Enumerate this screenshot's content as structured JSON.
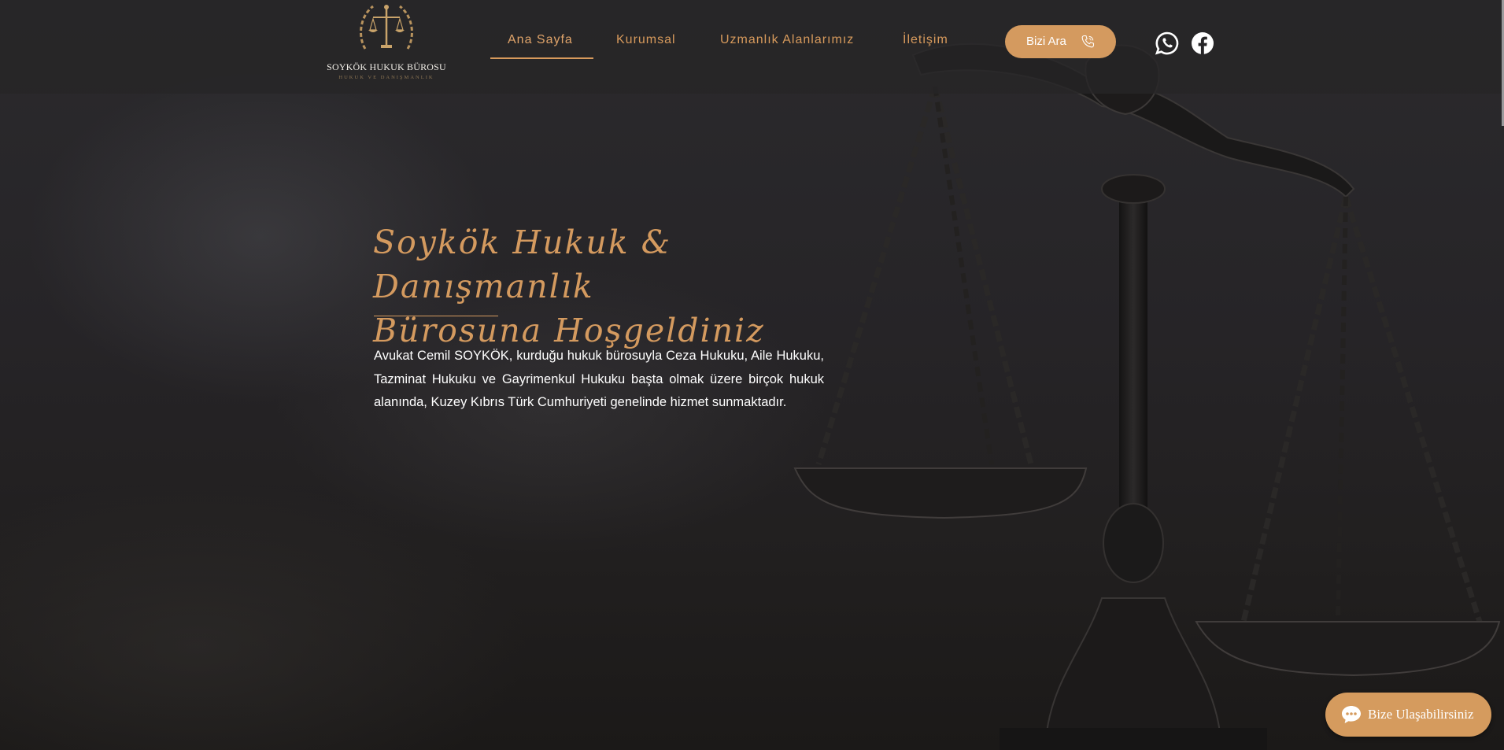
{
  "logo": {
    "name": "SOYKÖK HUKUK BÜROSU",
    "subtitle": "HUKUK VE DANIŞMANLIK",
    "icon": "scales-of-justice-icon"
  },
  "nav": {
    "items": [
      {
        "label": "Ana Sayfa",
        "active": true
      },
      {
        "label": "Kurumsal",
        "active": false
      },
      {
        "label": "Uzmanlık Alanlarımız",
        "active": false
      },
      {
        "label": "İletişim",
        "active": false
      }
    ]
  },
  "call_button": {
    "label": "Bizi Ara",
    "icon": "phone-icon"
  },
  "social": [
    {
      "icon": "whatsapp-icon"
    },
    {
      "icon": "facebook-icon"
    }
  ],
  "hero": {
    "title_line1": "Soykök Hukuk & Danışmanlık",
    "title_line2": "Bürosuna Hoşgeldiniz",
    "body": "Avukat Cemil SOYKÖK, kurduğu hukuk bürosuyla Ceza Hukuku, Aile Hukuku, Tazminat Hukuku ve Gayrimenkul Hukuku başta olmak üzere birçok hukuk alanında, Kuzey Kıbrıs Türk Cumhuriyeti genelinde hizmet sunmaktadır."
  },
  "chat": {
    "label": "Bize Ulaşabilirsiniz",
    "icon": "chat-bubble-icon"
  },
  "colors": {
    "accent": "#d49a5f",
    "topbar": "#262527",
    "text": "#ffffff"
  }
}
